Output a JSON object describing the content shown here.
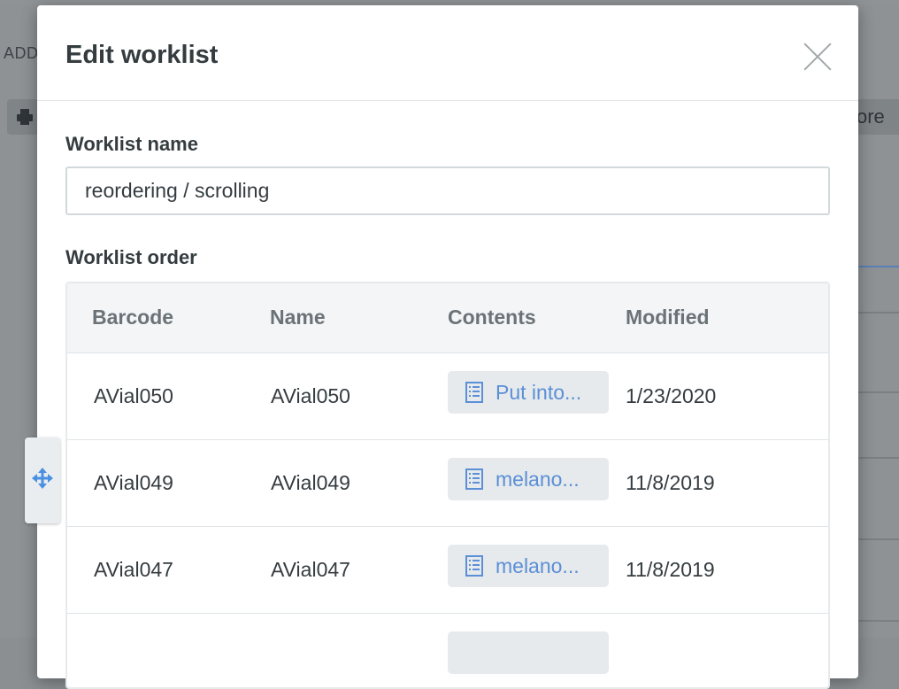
{
  "background": {
    "add_label": "ADD",
    "more_label": "ore"
  },
  "modal": {
    "title": "Edit worklist",
    "name_label": "Worklist name",
    "name_value": "reordering / scrolling",
    "order_label": "Worklist order",
    "columns": [
      "Barcode",
      "Name",
      "Contents",
      "Modified"
    ],
    "rows": [
      {
        "barcode": "AVial050",
        "name": "AVial050",
        "contents": "Put into...",
        "modified": "1/23/2020"
      },
      {
        "barcode": "AVial049",
        "name": "AVial049",
        "contents": "melano...",
        "modified": "11/8/2019"
      },
      {
        "barcode": "AVial047",
        "name": "AVial047",
        "contents": "melano...",
        "modified": "11/8/2019"
      }
    ]
  },
  "icons": {
    "close": "close-icon",
    "document": "document-list-icon",
    "move": "move-arrows-icon",
    "printer": "printer-icon"
  },
  "colors": {
    "link": "#5b8fd6",
    "move_icon": "#4a90e2"
  }
}
